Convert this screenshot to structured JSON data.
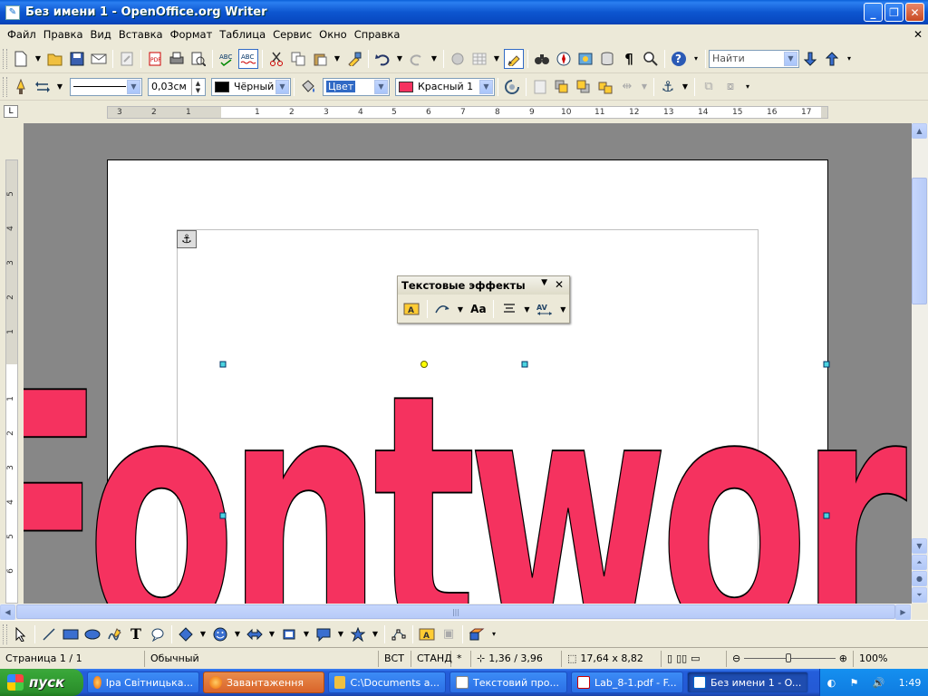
{
  "window": {
    "title": "Без имени 1 - OpenOffice.org Writer"
  },
  "menu": [
    "Файл",
    "Правка",
    "Вид",
    "Вставка",
    "Формат",
    "Таблица",
    "Сервис",
    "Окно",
    "Справка"
  ],
  "toolbar": {
    "search_placeholder": "Найти",
    "line_width": "0,03см",
    "line_color": "Чёрный",
    "line_color_hex": "#000000",
    "area_style": "Цвет",
    "area_color": "Красный 1",
    "area_color_hex": "#f5325f"
  },
  "ruler": {
    "h_ticks": [
      "3",
      "2",
      "1",
      "1",
      "2",
      "3",
      "4",
      "5",
      "6",
      "7",
      "8",
      "9",
      "10",
      "11",
      "12",
      "13",
      "14",
      "15",
      "16",
      "17"
    ],
    "v_ticks": [
      "5",
      "4",
      "3",
      "2",
      "1",
      "1",
      "2",
      "3",
      "4",
      "5",
      "6"
    ]
  },
  "fontwork": {
    "text": "Fontwork",
    "fill": "#f5325f",
    "stroke": "#000000"
  },
  "float_toolbar": {
    "title": "Текстовые эффекты"
  },
  "status": {
    "page": "Страница  1 / 1",
    "style": "Обычный",
    "insert": "ВСТ",
    "selection": "СТАНД",
    "modified": "*",
    "position": "1,36 / 3,96",
    "size": "17,64 x 8,82",
    "zoom": "100%"
  },
  "taskbar": {
    "start": "пуск",
    "tasks": [
      "Іра Світницька...",
      "Завантаження",
      "C:\\Documents a...",
      "Текстовий про...",
      "Lab_8-1.pdf - F...",
      "Без имени 1 - O..."
    ],
    "lang": "EN",
    "clock": "1:49"
  }
}
